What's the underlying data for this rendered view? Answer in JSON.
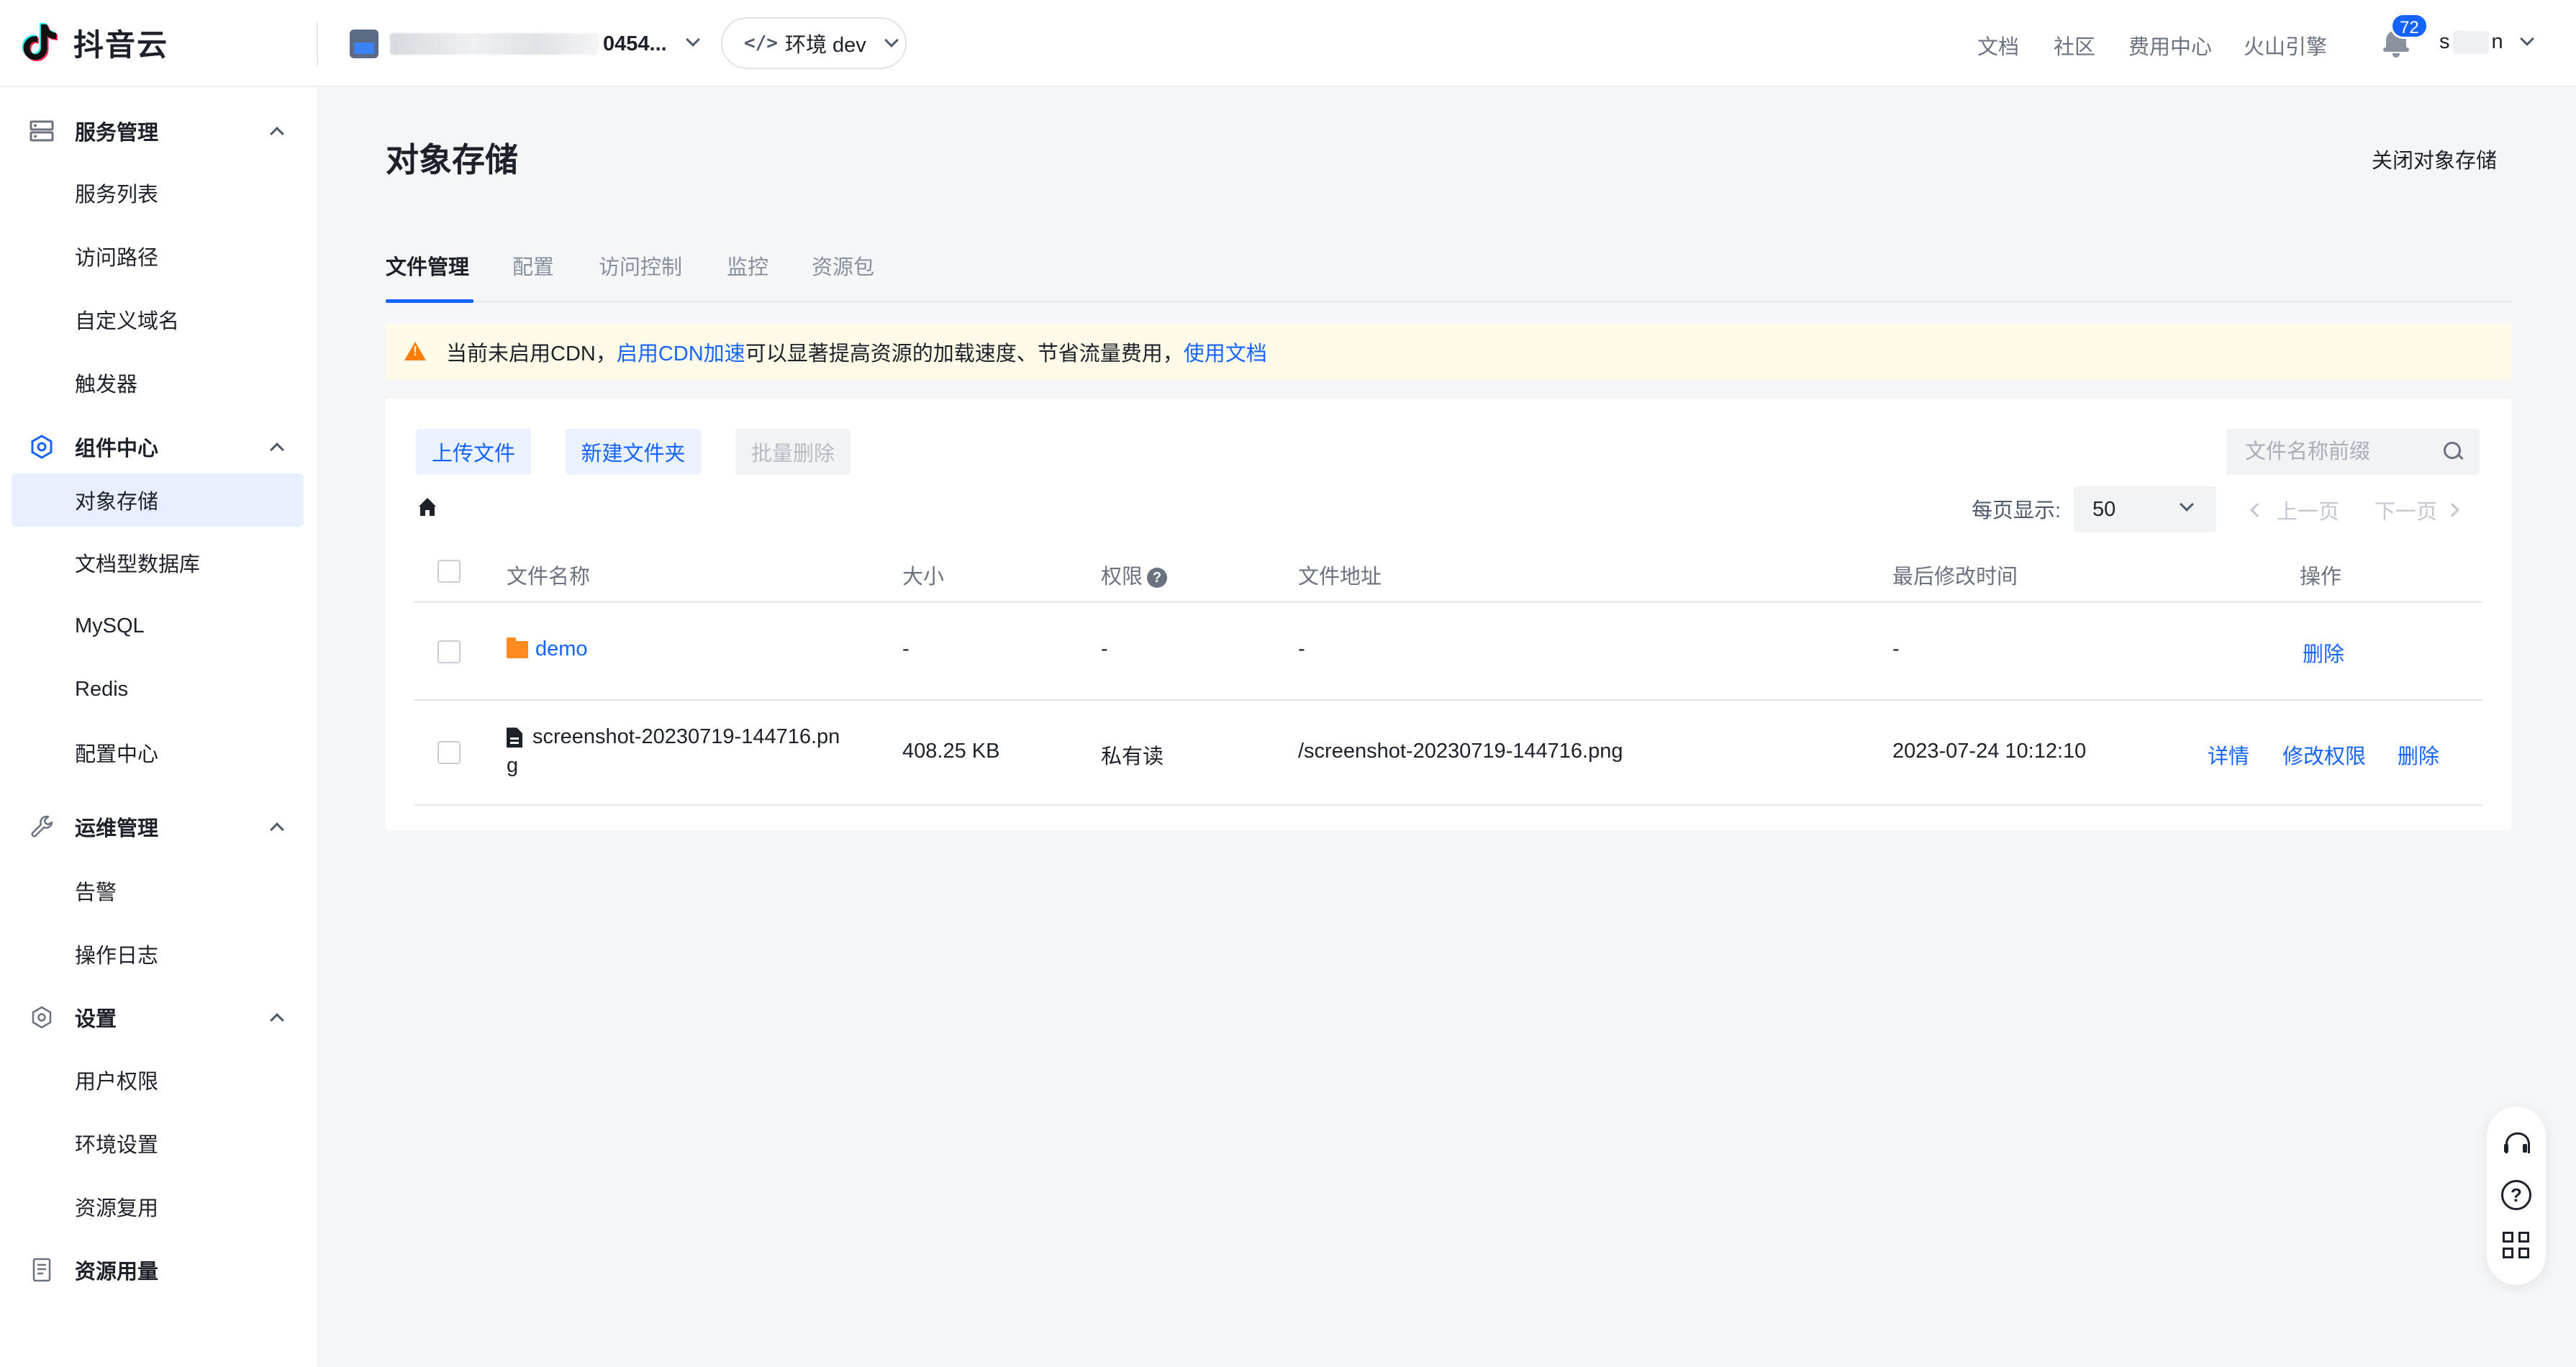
{
  "app": {
    "name": "抖音云"
  },
  "header": {
    "project_suffix": "0454...",
    "env_label": "环境 dev",
    "links": [
      "文档",
      "社区",
      "费用中心",
      "火山引擎"
    ],
    "notification_count": "72",
    "user_start": "s",
    "user_end": "n"
  },
  "sidebar": {
    "groups": [
      {
        "label": "服务管理",
        "items": [
          "服务列表",
          "访问路径",
          "自定义域名",
          "触发器"
        ]
      },
      {
        "label": "组件中心",
        "items": [
          "对象存储",
          "文档型数据库",
          "MySQL",
          "Redis",
          "配置中心"
        ]
      },
      {
        "label": "运维管理",
        "items": [
          "告警",
          "操作日志"
        ]
      },
      {
        "label": "设置",
        "items": [
          "用户权限",
          "环境设置",
          "资源复用"
        ]
      },
      {
        "label": "资源用量",
        "items": []
      }
    ],
    "active_item": "对象存储"
  },
  "page": {
    "title": "对象存储",
    "close_action": "关闭对象存储",
    "tabs": [
      "文件管理",
      "配置",
      "访问控制",
      "监控",
      "资源包"
    ],
    "active_tab": "文件管理"
  },
  "alert": {
    "text_before": "当前未启用CDN，",
    "link1": "启用CDN加速",
    "text_middle": "可以显著提高资源的加载速度、节省流量费用，",
    "link2": "使用文档",
    "color": "#fffbe8"
  },
  "toolbar": {
    "upload": "上传文件",
    "new_folder": "新建文件夹",
    "batch_delete": "批量删除",
    "search_placeholder": "文件名称前缀"
  },
  "pagination": {
    "page_size_label": "每页显示:",
    "page_size": "50",
    "prev": "上一页",
    "next": "下一页"
  },
  "table": {
    "columns": [
      "文件名称",
      "大小",
      "权限",
      "文件地址",
      "最后修改时间",
      "操作"
    ],
    "rows": [
      {
        "name": "demo",
        "type": "folder",
        "size": "-",
        "permission": "-",
        "path": "-",
        "modified": "-",
        "actions": [
          "删除"
        ]
      },
      {
        "name_line1": "screenshot-20230719-144716.pn",
        "name_line2": "g",
        "type": "file",
        "size": "408.25 KB",
        "permission": "私有读",
        "path": "/screenshot-20230719-144716.png",
        "modified": "2023-07-24 10:12:10",
        "actions": [
          "详情",
          "修改权限",
          "删除"
        ]
      }
    ]
  },
  "colors": {
    "accent": "#1664ff",
    "warning": "#ff7d00",
    "folder": "#ff8a1f"
  }
}
